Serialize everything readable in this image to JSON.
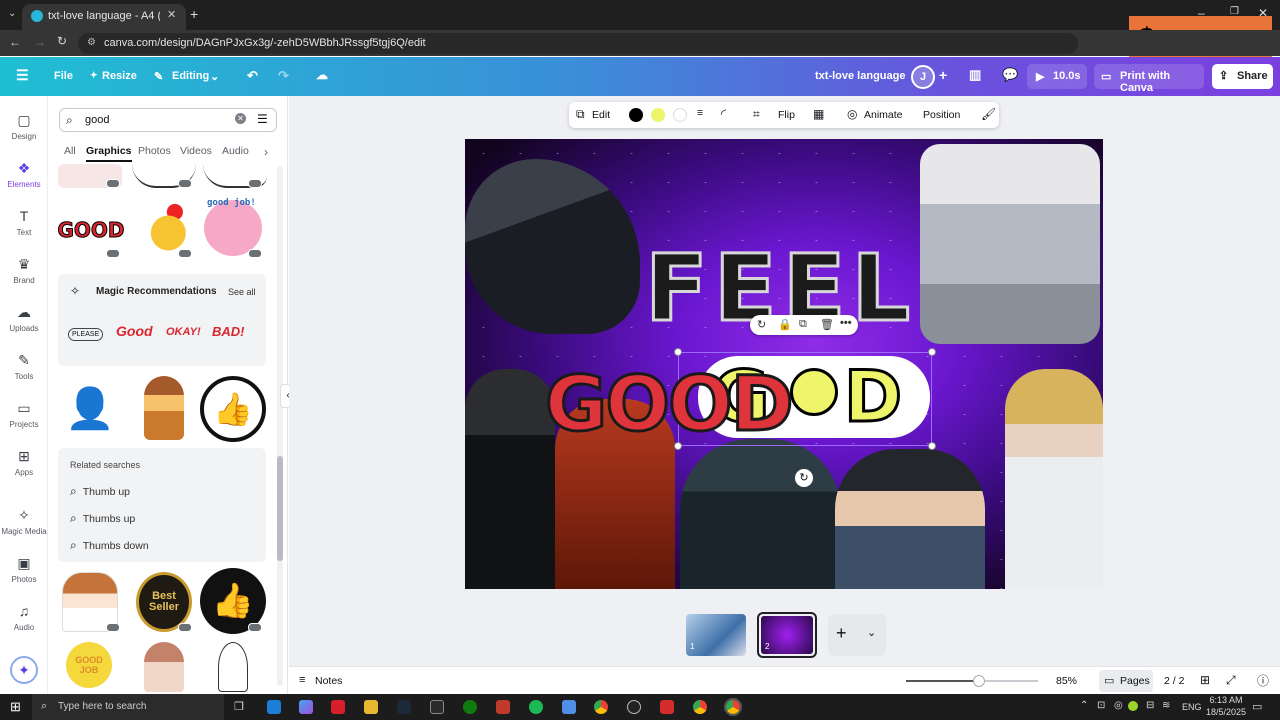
{
  "browser": {
    "tab_title": "txt-love language - A4 (Landsc",
    "url": "canva.com/design/DAGnPJxGx3g/-zehD5WBbhJRssgf5tgj6Q/edit",
    "overlay_text": "$"
  },
  "header": {
    "file": "File",
    "resize": "Resize",
    "editing": "Editing",
    "doc_title": "txt-love language",
    "avatar_initial": "J",
    "duration": "10.0s",
    "print": "Print with Canva",
    "share": "Share"
  },
  "rail": [
    {
      "label": "Design",
      "icon": "design-icon"
    },
    {
      "label": "Elements",
      "icon": "elements-icon"
    },
    {
      "label": "Text",
      "icon": "text-icon"
    },
    {
      "label": "Brand",
      "icon": "brand-icon"
    },
    {
      "label": "Uploads",
      "icon": "uploads-icon"
    },
    {
      "label": "Tools",
      "icon": "tools-icon"
    },
    {
      "label": "Projects",
      "icon": "projects-icon"
    },
    {
      "label": "Apps",
      "icon": "apps-icon"
    },
    {
      "label": "Magic Media",
      "icon": "magic-media-icon"
    },
    {
      "label": "Photos",
      "icon": "photos-icon"
    },
    {
      "label": "Audio",
      "icon": "audio-icon"
    }
  ],
  "panel": {
    "search_value": "good",
    "tabs": [
      "All",
      "Graphics",
      "Photos",
      "Videos",
      "Audio"
    ],
    "active_tab": "Graphics",
    "magic_title": "Magic Recommendations",
    "see_all": "See all",
    "related_title": "Related searches",
    "related": [
      "Thumb up",
      "Thumbs up",
      "Thumbs down"
    ],
    "graphic_good": "GOOD",
    "graphic_good_job": "good job!",
    "mini_please": "PLEASE",
    "mini_good": "Good",
    "mini_okay": "OKAY!",
    "mini_bad": "BAD!",
    "best_seller_1": "Best",
    "best_seller_2": "Seller",
    "good_job_round": "GOOD JOB"
  },
  "toolbar": {
    "edit": "Edit",
    "flip": "Flip",
    "animate": "Animate",
    "position": "Position",
    "colors": [
      "#000000",
      "#eef56a",
      "#ffffff"
    ]
  },
  "canvas": {
    "word_feel": "FEEL",
    "word_good_red": "GOOD",
    "word_good_yellow": "G",
    "word_good_yellow_end": "D"
  },
  "footer": {
    "notes": "Notes",
    "zoom": "85%",
    "zoom_fraction": 0.55,
    "pages": "Pages",
    "page_count": "2 / 2",
    "page1_num": "1",
    "page2_num": "2"
  },
  "taskbar": {
    "search_placeholder": "Type here to search",
    "lang": "ENG",
    "time": "6:13 AM",
    "date": "18/5/2025"
  }
}
